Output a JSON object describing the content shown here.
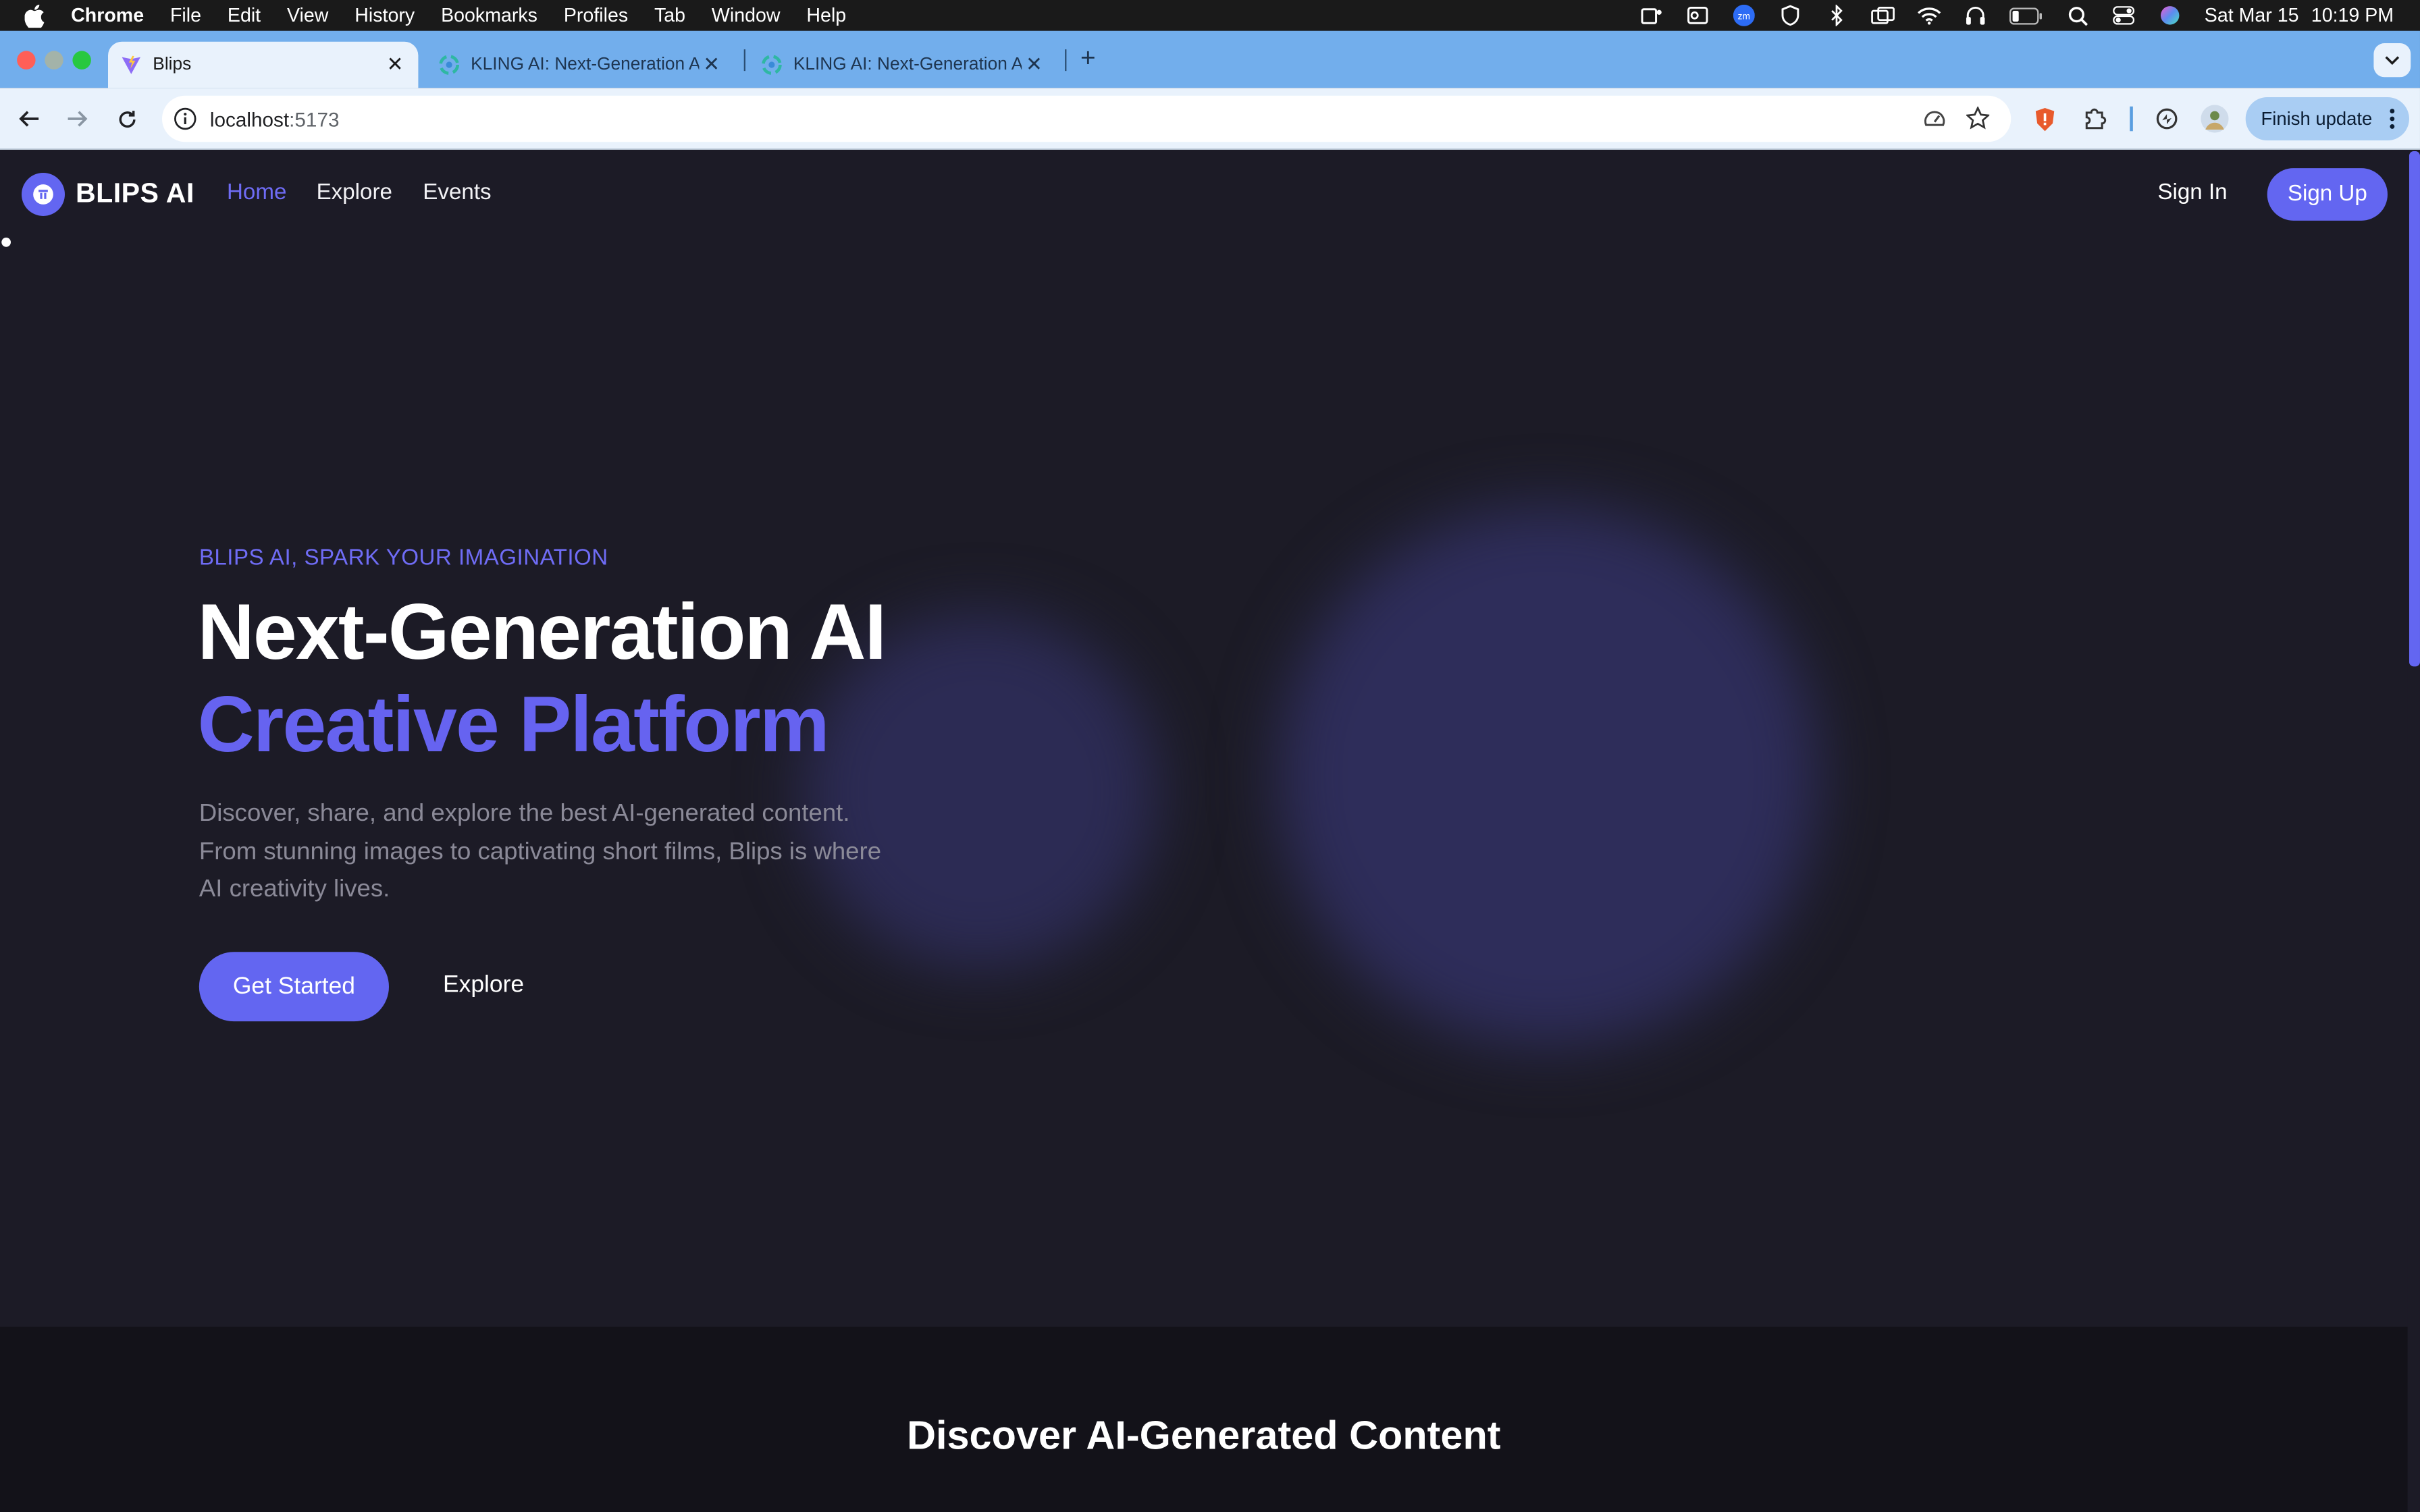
{
  "menubar": {
    "app": "Chrome",
    "items": [
      "File",
      "Edit",
      "View",
      "History",
      "Bookmarks",
      "Profiles",
      "Tab",
      "Window",
      "Help"
    ],
    "date": "Sat Mar 15",
    "time": "10:19 PM"
  },
  "tabs": [
    {
      "title": "Blips",
      "active": true
    },
    {
      "title": "KLING AI: Next-Generation AI",
      "active": false
    },
    {
      "title": "KLING AI: Next-Generation AI",
      "active": false
    }
  ],
  "toolbar": {
    "url_host": "localhost",
    "url_port": ":5173",
    "finish_update": "Finish update"
  },
  "nav": {
    "brand": "BLIPS AI",
    "links": [
      "Home",
      "Explore",
      "Events"
    ],
    "sign_in": "Sign In",
    "sign_up": "Sign Up"
  },
  "hero": {
    "eyebrow": "BLIPS AI, SPARK YOUR IMAGINATION",
    "title_line1": "Next-Generation AI",
    "title_line2": "Creative Platform",
    "description": "Discover, share, and explore the best AI-generated content. From stunning images to captivating short films, Blips is where AI creativity lives.",
    "primary_cta": "Get Started",
    "secondary_cta": "Explore"
  },
  "section2": {
    "heading": "Discover AI-Generated Content"
  },
  "colors": {
    "accent": "#6366f1",
    "page_bg": "#1c1b26",
    "section_bg": "#131219",
    "tabstrip": "#72aeec"
  }
}
